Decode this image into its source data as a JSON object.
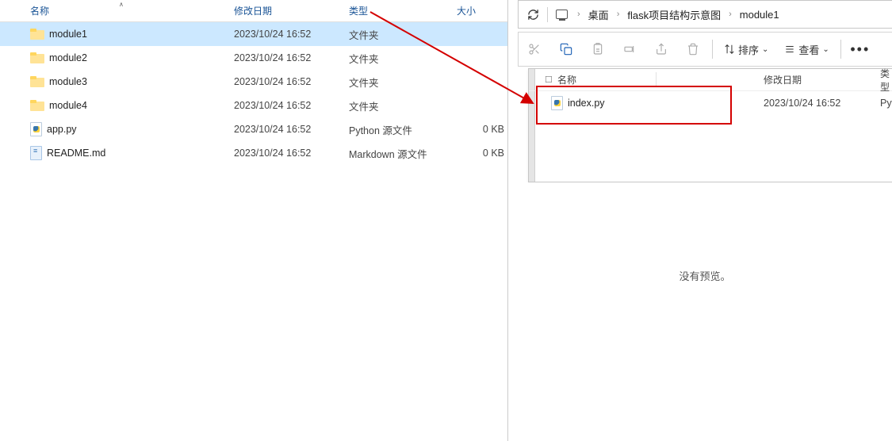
{
  "left": {
    "header": {
      "name": "名称",
      "date": "修改日期",
      "type": "类型",
      "size": "大小"
    },
    "rows": [
      {
        "name": "module1",
        "date": "2023/10/24 16:52",
        "type": "文件夹",
        "size": ""
      },
      {
        "name": "module2",
        "date": "2023/10/24 16:52",
        "type": "文件夹",
        "size": ""
      },
      {
        "name": "module3",
        "date": "2023/10/24 16:52",
        "type": "文件夹",
        "size": ""
      },
      {
        "name": "module4",
        "date": "2023/10/24 16:52",
        "type": "文件夹",
        "size": ""
      },
      {
        "name": "app.py",
        "date": "2023/10/24 16:52",
        "type": "Python 源文件",
        "size": "0 KB"
      },
      {
        "name": "README.md",
        "date": "2023/10/24 16:52",
        "type": "Markdown 源文件",
        "size": "0 KB"
      }
    ]
  },
  "breadcrumbs": [
    "桌面",
    "flask项目结构示意图",
    "module1"
  ],
  "toolbar": {
    "sort": "排序",
    "view": "查看"
  },
  "right": {
    "header": {
      "name": "名称",
      "date": "修改日期",
      "type": "类型"
    },
    "rows": [
      {
        "name": "index.py",
        "date": "2023/10/24 16:52",
        "type": "Pyt"
      }
    ]
  },
  "preview": {
    "empty": "没有预览。"
  }
}
